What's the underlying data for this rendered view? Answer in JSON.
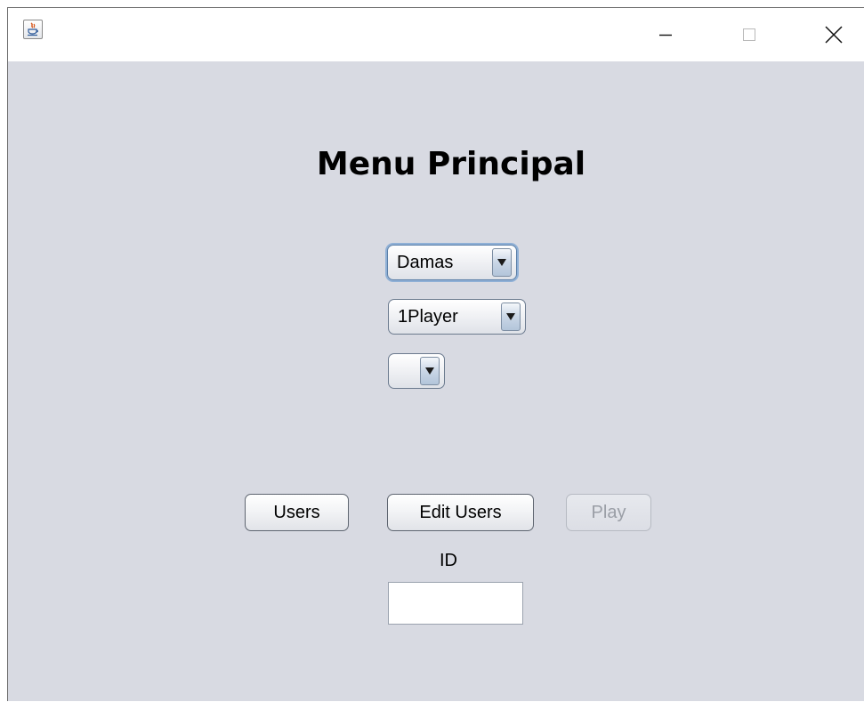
{
  "window": {
    "title": "",
    "icon": "java-icon",
    "controls": {
      "minimize_icon": "minimize-icon",
      "maximize_icon": "maximize-icon",
      "close_icon": "close-icon"
    }
  },
  "menu": {
    "title": "Menu Principal"
  },
  "combos": {
    "game": {
      "value": "Damas"
    },
    "players": {
      "value": "1Player"
    },
    "extra": {
      "value": ""
    }
  },
  "buttons": {
    "users": "Users",
    "edit_users": "Edit Users",
    "play": "Play"
  },
  "id_field": {
    "label": "ID",
    "value": ""
  },
  "colors": {
    "background": "#d8dae2",
    "focus_ring": "#8fb0d6",
    "disabled_text": "#9a9ea6"
  }
}
